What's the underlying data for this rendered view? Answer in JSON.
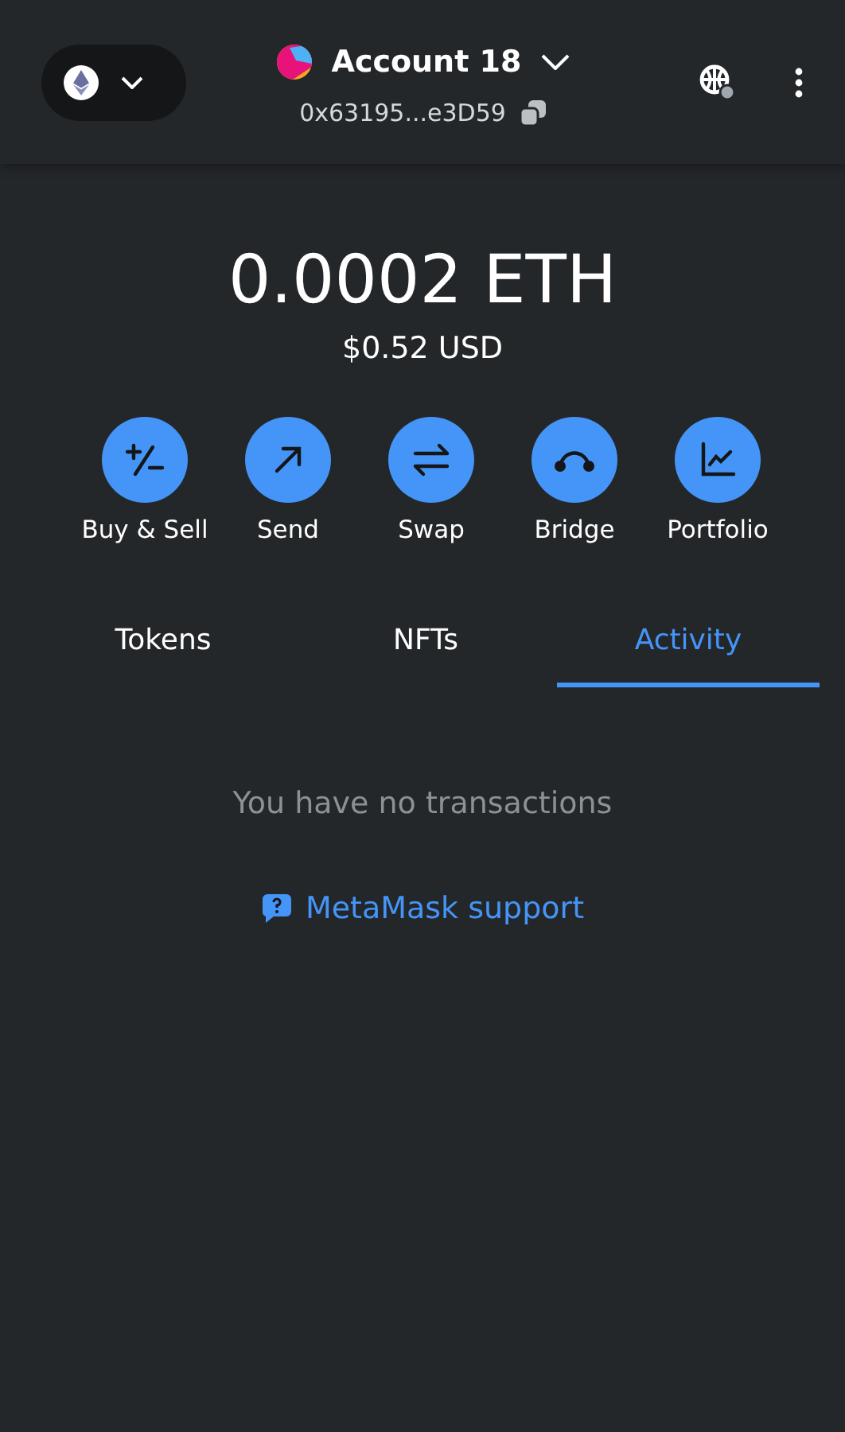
{
  "header": {
    "account_name": "Account 18",
    "address": "0x63195...e3D59"
  },
  "balance": {
    "primary": "0.0002 ETH",
    "secondary": "$0.52 USD"
  },
  "actions": [
    {
      "kind": "buy-sell",
      "label": "Buy & Sell"
    },
    {
      "kind": "send",
      "label": "Send"
    },
    {
      "kind": "swap",
      "label": "Swap"
    },
    {
      "kind": "bridge",
      "label": "Bridge"
    },
    {
      "kind": "portfolio",
      "label": "Portfolio"
    }
  ],
  "tabs": [
    {
      "label": "Tokens",
      "selected": false
    },
    {
      "label": "NFTs",
      "selected": false
    },
    {
      "label": "Activity",
      "selected": true
    }
  ],
  "empty_message": "You have no transactions",
  "support_link": "MetaMask support"
}
